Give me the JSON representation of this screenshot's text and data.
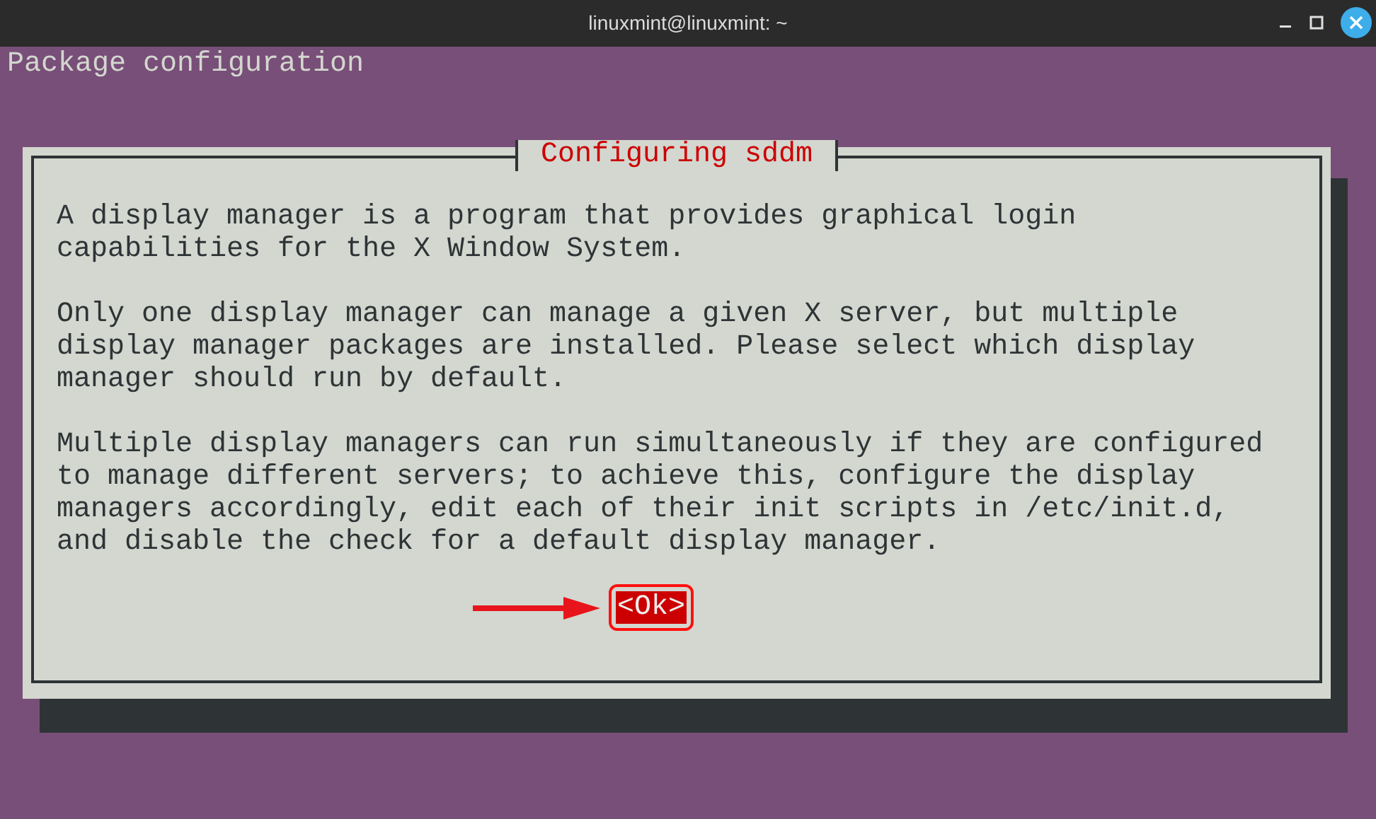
{
  "window": {
    "title": "linuxmint@linuxmint: ~"
  },
  "terminal": {
    "header": "Package configuration"
  },
  "dialog": {
    "title": "Configuring sddm",
    "paragraphs": [
      "A display manager is a program that provides graphical login capabilities for the X Window System.",
      "Only one display manager can manage a given X server, but multiple display manager packages are installed. Please select which display manager should run by default.",
      "Multiple display managers can run simultaneously if they are configured to manage different servers; to achieve this, configure the display managers accordingly, edit each of their init scripts in /etc/init.d, and disable the check for a default display manager."
    ],
    "button": {
      "label": "<Ok>",
      "selected": true
    }
  }
}
